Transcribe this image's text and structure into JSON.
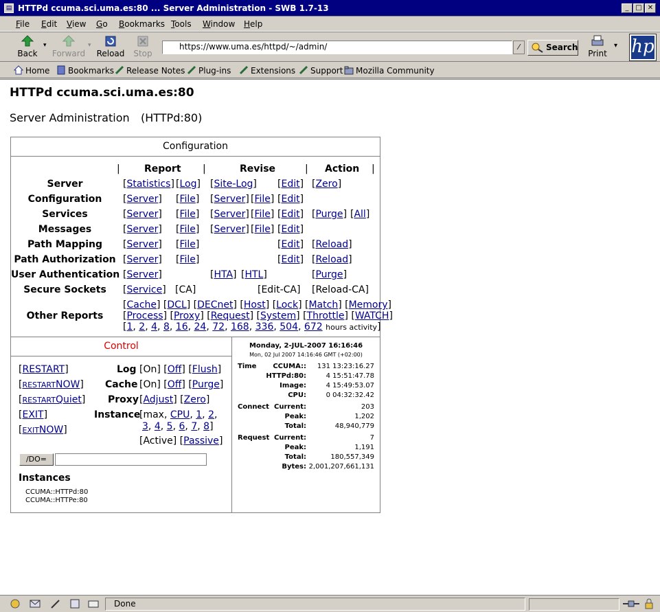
{
  "window": {
    "title": "HTTPd ccuma.sci.uma.es:80 ... Server Administration - SWB 1.7-13"
  },
  "menu": [
    "File",
    "Edit",
    "View",
    "Go",
    "Bookmarks",
    "Tools",
    "Window",
    "Help"
  ],
  "nav": {
    "back": "Back",
    "forward": "Forward",
    "reload": "Reload",
    "stop": "Stop",
    "print": "Print",
    "search": "Search",
    "url": "https://www.uma.es/httpd/~/admin/",
    "logo": "hp"
  },
  "bookmarks": [
    "Home",
    "Bookmarks",
    "Release Notes",
    "Plug-ins",
    "Extensions",
    "Support",
    "Mozilla Community"
  ],
  "page": {
    "title": "HTTPd ccuma.sci.uma.es:80",
    "subtitle": "Server Administration",
    "subtitle_port": "(HTTPd:80)",
    "configuration": {
      "heading": "Configuration",
      "col_report": "Report",
      "col_revise": "Revise",
      "col_action": "Action",
      "rows": {
        "server": "Server",
        "configuration": "Configuration",
        "services": "Services",
        "messages": "Messages",
        "path_mapping": "Path Mapping",
        "path_auth": "Path Authorization",
        "user_auth": "User Authentication",
        "secure_sockets": "Secure Sockets",
        "other_reports": "Other Reports"
      },
      "links": {
        "statistics": "Statistics",
        "log": "Log",
        "site_log": "Site-Log",
        "edit": "Edit",
        "zero": "Zero",
        "server": "Server",
        "file": "File",
        "purge": "Purge",
        "all": "All",
        "reload": "Reload",
        "hta": "HTA",
        "htl": "HTL",
        "service": "Service",
        "ca": "[CA]",
        "edit_ca": "[Edit-CA]",
        "reload_ca": "[Reload-CA]",
        "cache": "Cache",
        "dcl": "DCL",
        "decnet": "DECnet",
        "host": "Host",
        "lock": "Lock",
        "match": "Match",
        "memory": "Memory",
        "process": "Process",
        "proxy": "Proxy",
        "request": "Request",
        "system": "System",
        "throttle": "Throttle",
        "watch": "WATCH",
        "hours": [
          "1",
          "2",
          "4",
          "8",
          "16",
          "24",
          "72",
          "168",
          "336",
          "504",
          "672"
        ],
        "hours_activity": "hours activity"
      }
    },
    "control": {
      "heading": "Control",
      "restart": "RESTART",
      "restart_now_a": "RESTART",
      "restart_now_b": "NOW",
      "restart_quiet_a": "RESTART",
      "restart_quiet_b": "Quiet",
      "exit": "EXIT",
      "exit_now_a": "EXIT",
      "exit_now_b": "NOW",
      "log": "Log",
      "cache": "Cache",
      "proxy": "Proxy",
      "instance": "Instance",
      "on": "[On]",
      "off": "Off",
      "flush": "Flush",
      "purge": "Purge",
      "adjust": "Adjust",
      "zero": "Zero",
      "max": "[max,",
      "cpu": "CPU",
      "inst_nums": [
        "1",
        "2",
        "3",
        "4",
        "5",
        "6",
        "7",
        "8"
      ],
      "active": "[Active]",
      "passive": "Passive",
      "do_label": "/DO=",
      "instances_title": "Instances",
      "instances": [
        "CCUMA::HTTPd:80",
        "CCUMA::HTTPe:80"
      ]
    },
    "stats": {
      "date": "Monday, 2-JUL-2007 16:16:46",
      "date_small": "Mon, 02 Jul 2007 14:16:46 GMT (+02:00)",
      "time_label": "Time",
      "time": [
        [
          "CCUMA::",
          "131 13:23:16.27"
        ],
        [
          "HTTPd:80:",
          "4 15:51:47.78"
        ],
        [
          "Image:",
          "4 15:49:53.07"
        ],
        [
          "CPU:",
          "0 04:32:32.42"
        ]
      ],
      "connect_label": "Connect",
      "connect": [
        [
          "Current:",
          "203"
        ],
        [
          "Peak:",
          "1,202"
        ],
        [
          "Total:",
          "48,940,779"
        ]
      ],
      "request_label": "Request",
      "request": [
        [
          "Current:",
          "7"
        ],
        [
          "Peak:",
          "1,191"
        ],
        [
          "Total:",
          "180,557,349"
        ],
        [
          "Bytes:",
          "2,001,207,661,131"
        ]
      ]
    }
  },
  "status": {
    "text": "Done"
  }
}
